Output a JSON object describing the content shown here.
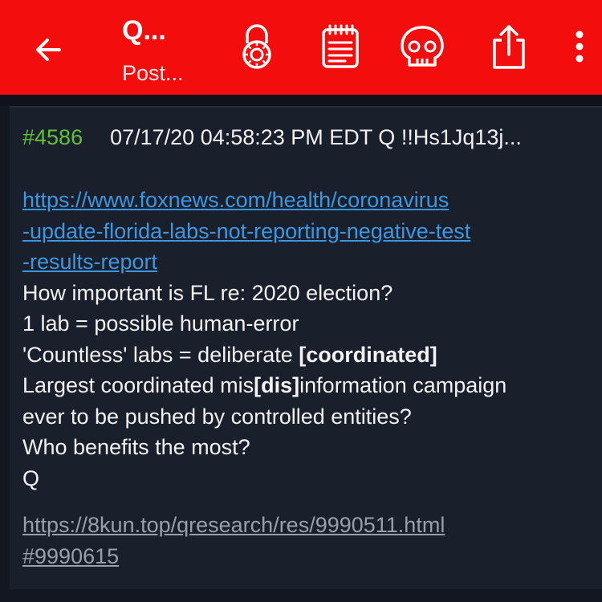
{
  "appbar": {
    "title": "Q...",
    "subtitle": "Post...",
    "icons": [
      "back-arrow-icon",
      "lock-icon",
      "notepad-icon",
      "skull-icon",
      "share-icon",
      "more-vert-icon"
    ],
    "color": "#f40d0d"
  },
  "post": {
    "number": "#4586",
    "meta": "07/17/20 04:58:23 PM EDT Q !!Hs1Jq13j...",
    "link_lines": [
      "https://www.foxnews.com/health/coronavirus",
      "-update-florida-labs-not-reporting-negative-test",
      "-results-report"
    ],
    "line1": "How important is FL re: 2020 election?",
    "line2": "1 lab = possible human-error",
    "line3_pre": "'Countless' labs = deliberate ",
    "line3_bold": "[coordinated]",
    "line4_pre": "Largest coordinated mis",
    "line4_bold": "[dis]",
    "line4_post": "information campaign",
    "line5": "ever to be pushed by controlled entities?",
    "line6": "Who benefits the most?",
    "line7": "Q",
    "source_lines": [
      "https://8kun.top/qresearch/res/9990511.html",
      "#9990615"
    ]
  }
}
